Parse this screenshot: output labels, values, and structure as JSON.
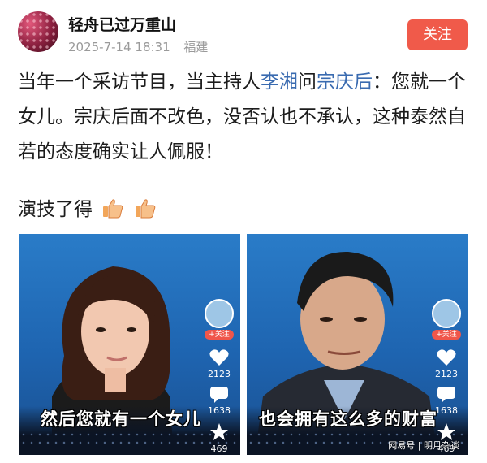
{
  "header": {
    "author": "轻舟已过万重山",
    "date": "2025-7-14 18:31",
    "location": "福建",
    "follow_label": "关注"
  },
  "post": {
    "t1": "当年一个采访节目，当主持人",
    "link1": "李湘",
    "t2": "问",
    "link2": "宗庆后",
    "t3": "：您就一个女儿。宗庆后面不改色，没否认也不承认，这种泰然自若的态度确实让人佩服！",
    "line2": "演技了得"
  },
  "panels": [
    {
      "caption": "然后您就有一个女儿",
      "follow_small": "+关注",
      "likes": "2123",
      "comments": "1638",
      "favorites": "469"
    },
    {
      "caption": "也会拥有这么多的财富",
      "follow_small": "+关注",
      "likes": "2123",
      "comments": "1638",
      "favorites": "469"
    }
  ],
  "watermark": "网易号 | 明月杂谈",
  "colors": {
    "accent": "#f05a4a",
    "link": "#3a6bb0"
  }
}
